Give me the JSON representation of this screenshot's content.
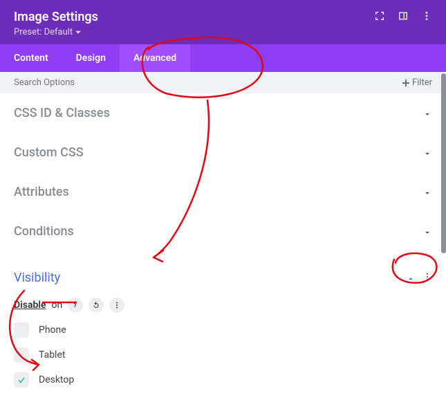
{
  "header": {
    "title": "Image Settings",
    "preset_label": "Preset: Default"
  },
  "tabs": [
    {
      "label": "Content",
      "active": false
    },
    {
      "label": "Design",
      "active": false
    },
    {
      "label": "Advanced",
      "active": true
    }
  ],
  "search": {
    "placeholder": "Search Options",
    "filter_label": "Filter"
  },
  "sections": [
    {
      "title": "CSS ID & Classes",
      "open": false
    },
    {
      "title": "Custom CSS",
      "open": false
    },
    {
      "title": "Attributes",
      "open": false
    },
    {
      "title": "Conditions",
      "open": false
    },
    {
      "title": "Visibility",
      "open": true
    }
  ],
  "visibility": {
    "disable_label": "Disable",
    "on_label": "on",
    "options": [
      {
        "label": "Phone",
        "checked": false
      },
      {
        "label": "Tablet",
        "checked": false
      },
      {
        "label": "Desktop",
        "checked": true
      }
    ]
  }
}
